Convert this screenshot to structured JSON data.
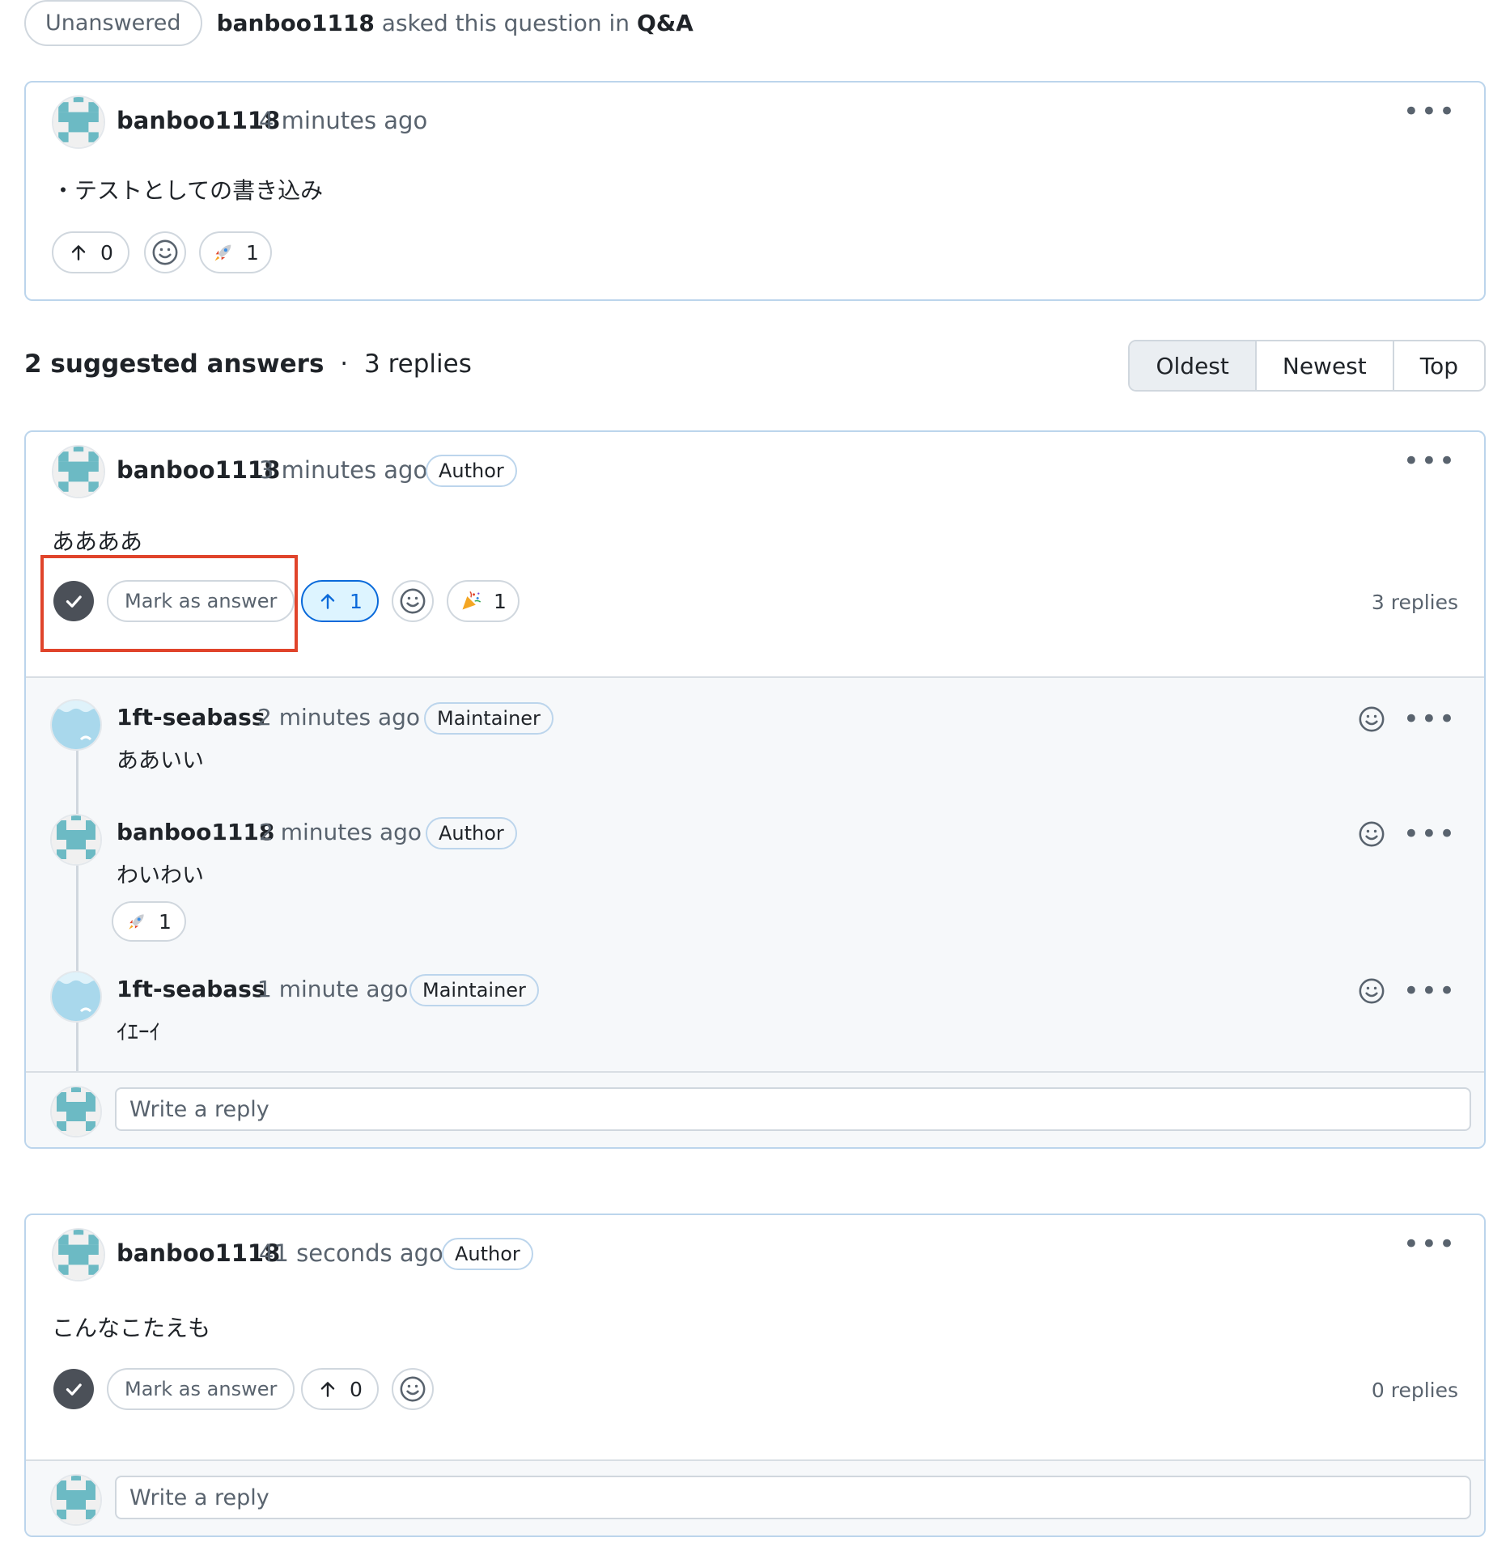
{
  "header": {
    "state_label": "Unanswered",
    "asker": "banboo1118",
    "asked_text": "asked this question in",
    "category": "Q&A"
  },
  "question": {
    "user": "banboo1118",
    "time": "4 minutes ago",
    "body": "・テストとしての書き込み",
    "upvotes": "0",
    "reaction_count": "1"
  },
  "answers_header": {
    "suggested": "2 suggested answers",
    "separator": "·",
    "replies": "3 replies",
    "sort": [
      "Oldest",
      "Newest",
      "Top"
    ]
  },
  "answer1": {
    "user": "banboo1118",
    "time": "3 minutes ago",
    "badge": "Author",
    "body": "ああああ",
    "mark_label": "Mark as answer",
    "upvotes": "1",
    "reaction_count": "1",
    "replies_label": "3 replies",
    "replies": [
      {
        "user": "1ft-seabass",
        "time": "2 minutes ago",
        "badge": "Maintainer",
        "body": "ああいい"
      },
      {
        "user": "banboo1118",
        "time": "2 minutes ago",
        "badge": "Author",
        "body": "わいわい",
        "reaction_count": "1"
      },
      {
        "user": "1ft-seabass",
        "time": "1 minute ago",
        "badge": "Maintainer",
        "body": "ｲｴｰｲ"
      }
    ],
    "reply_placeholder": "Write a reply"
  },
  "answer2": {
    "user": "banboo1118",
    "time": "41 seconds ago",
    "badge": "Author",
    "body": "こんなこたえも",
    "mark_label": "Mark as answer",
    "upvotes": "0",
    "replies_label": "0 replies",
    "reply_placeholder": "Write a reply"
  },
  "colors": {
    "accent": "#0969da",
    "card_border": "#bcd5ec",
    "highlight": "#e0442b",
    "check_bg": "#4b5058"
  }
}
